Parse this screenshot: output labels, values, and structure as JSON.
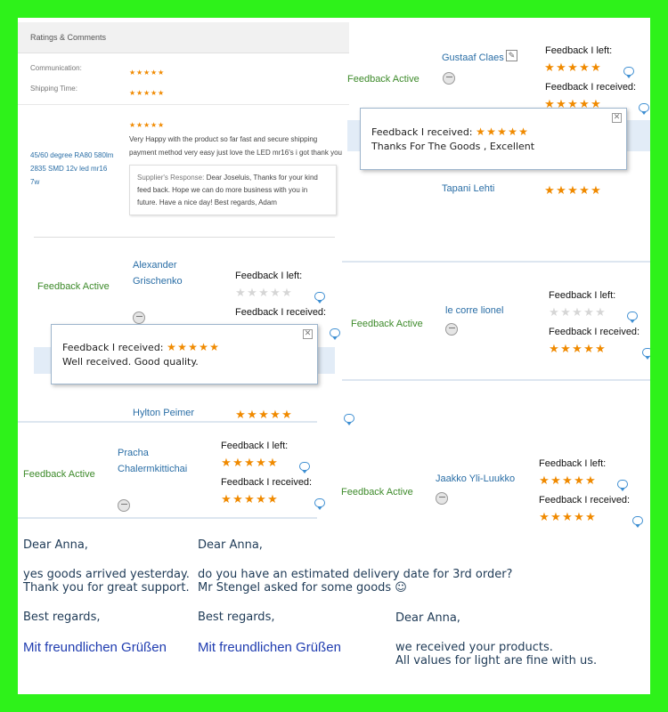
{
  "top_left_panel": {
    "title": "Ratings & Comments",
    "rows": [
      {
        "label": "Communication:",
        "stars": 5
      },
      {
        "label": "Shipping Time:",
        "stars": 5
      }
    ],
    "product": "45/60 degree RA80 580lm 2835 SMD 12v led mr16 7w",
    "stars": 5,
    "comment": "Very Happy with the product so far fast and secure shipping payment method very easy just love the LED mr16's i got thank you",
    "response_label": "Supplier's Response:",
    "response": "Dear Joseluis, Thanks for your kind feed back. Hope we can do more business with you in future. Have a nice day! Best regards, Adam"
  },
  "labels": {
    "feedback_active": "Feedback Active",
    "left": "Feedback I left:",
    "received": "Feedback I received:"
  },
  "feedback_blocks": [
    {
      "id": "gustaaf",
      "name": "Gustaaf Claes",
      "left_stars": 5,
      "received_stars": 5
    },
    {
      "id": "tapani",
      "name": "Tapani Lehti",
      "left_stars": 5
    },
    {
      "id": "alexander",
      "name_line1": "Alexander",
      "name_line2": "Grischenko",
      "left_stars": 0,
      "received_stars": 5
    },
    {
      "id": "hylton",
      "name": "Hylton Peimer",
      "left_stars": 5
    },
    {
      "id": "lionel",
      "name": "le corre lionel",
      "left_stars": 0,
      "received_stars": 5
    },
    {
      "id": "pracha",
      "name_line1": "Pracha",
      "name_line2": "Chalermkittichai",
      "left_stars": 5,
      "received_stars": 5
    },
    {
      "id": "jaakko",
      "name": "Jaakko Yli-Luukko",
      "left_stars": 5,
      "received_stars": 5
    }
  ],
  "popups": [
    {
      "id": "popup-gustaaf",
      "title": "Feedback I received:",
      "stars": 5,
      "text": "Thanks For The Goods , Excellent"
    },
    {
      "id": "popup-alexander",
      "title": "Feedback I received:",
      "stars": 5,
      "text": "Well received. Good quality."
    }
  ],
  "letters": [
    {
      "greeting": "Dear Anna,",
      "lines": [
        "yes goods arrived yesterday.",
        "Thank you for great support."
      ],
      "closing": "Best regards,",
      "signature": "Mit freundlichen Grüßen"
    },
    {
      "greeting": "Dear Anna,",
      "lines": [
        "do you have an estimated delivery date for 3rd order?",
        "Mr Stengel asked for some goods ☺"
      ],
      "closing": "Best regards,",
      "signature": "Mit freundlichen Grüßen"
    },
    {
      "greeting": "Dear Anna,",
      "lines": [
        "we received your products.",
        "All values for light are fine with us."
      ]
    }
  ],
  "colors": {
    "background": "#2ef21a",
    "star": "#f08a00",
    "link": "#2a6ea6",
    "active": "#3d8a2a"
  }
}
